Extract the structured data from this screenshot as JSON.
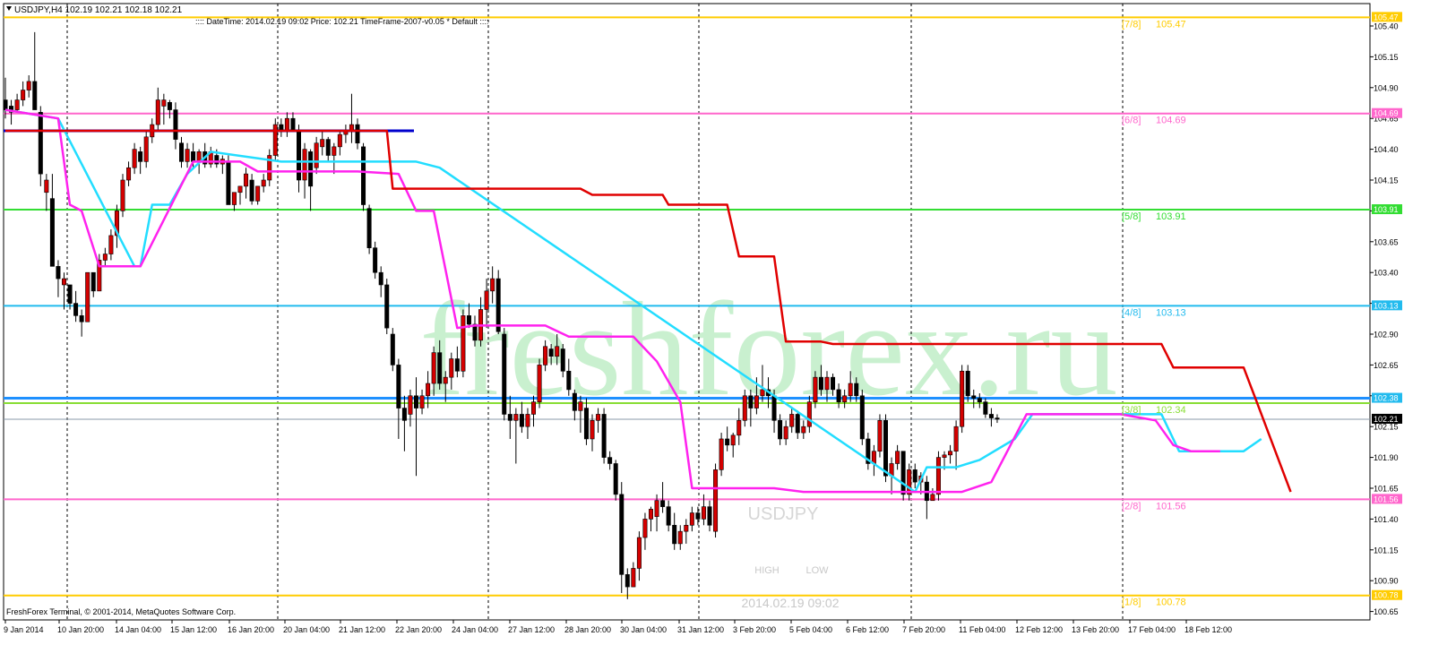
{
  "header": {
    "menu_icon": "triangle-down-icon",
    "symbol_line": "USDJPY,H4  102.19 102.21 102.18 102.21",
    "info_line": ":::: DateTime: 2014.02.19 09:02   Price: 102.21   TimeFrame-2007-v0.05    *  Default   ::::"
  },
  "footer": {
    "copyright": "FreshForex Terminal, © 2001-2014, MetaQuotes Software Corp."
  },
  "watermark": {
    "text": "freshforex.ru",
    "symbol": "USDJPY",
    "time": "2014.02.19 09:02",
    "high": "HIGH",
    "low": "LOW"
  },
  "colors": {
    "bull": "#ffffff",
    "bear": "#000000",
    "bull_body": "#d40000",
    "wick": "#000000",
    "red_line": "#e00000",
    "magenta": "#ff22ee",
    "cyan": "#22ddff",
    "blue_line": "#0000cc",
    "watermark": "#c9f0cf"
  },
  "chart_data": {
    "type": "candlestick",
    "symbol": "USDJPY",
    "timeframe": "H4",
    "ylim": [
      100.55,
      105.6
    ],
    "y_ticks": [
      "105.40",
      "105.15",
      "104.90",
      "104.65",
      "104.40",
      "104.15",
      "103.90",
      "103.65",
      "103.40",
      "103.15",
      "102.90",
      "102.65",
      "102.40",
      "102.15",
      "101.90",
      "101.65",
      "101.40",
      "101.15",
      "100.90",
      "100.65"
    ],
    "x_ticks": [
      "9 Jan 2014",
      "10 Jan 20:00",
      "14 Jan 04:00",
      "15 Jan 12:00",
      "16 Jan 20:00",
      "20 Jan 04:00",
      "21 Jan 12:00",
      "22 Jan 20:00",
      "24 Jan 04:00",
      "27 Jan 12:00",
      "28 Jan 20:00",
      "30 Jan 04:00",
      "31 Jan 12:00",
      "3 Feb 20:00",
      "5 Feb 04:00",
      "6 Feb 12:00",
      "7 Feb 20:00",
      "11 Feb 04:00",
      "12 Feb 12:00",
      "13 Feb 20:00",
      "17 Feb 04:00",
      "18 Feb 12:00"
    ],
    "current_price": "102.21",
    "murrey_levels": [
      {
        "label": "7/8",
        "value": "105.47",
        "color": "#ffcc00"
      },
      {
        "label": "6/8",
        "value": "104.69",
        "color": "#ff66cc"
      },
      {
        "label": "5/8",
        "value": "103.91",
        "color": "#33dd33"
      },
      {
        "label": "4/8",
        "value": "103.13",
        "color": "#22bbee"
      },
      {
        "label": "3/8",
        "value": "102.34",
        "color": "#88dd33"
      },
      {
        "label": "2/8",
        "value": "101.56",
        "color": "#ff66cc"
      },
      {
        "label": "1/8",
        "value": "100.78",
        "color": "#ffcc00"
      }
    ],
    "blue_levels": [
      "104.55",
      "102.38"
    ],
    "right_axis_tags": [
      {
        "value": "105.47",
        "color": "#ffcc00"
      },
      {
        "value": "104.69",
        "color": "#ff66cc"
      },
      {
        "value": "103.91",
        "color": "#33dd33"
      },
      {
        "value": "103.13",
        "color": "#22bbee"
      },
      {
        "value": "102.38",
        "color": "#22bbee"
      },
      {
        "value": "101.56",
        "color": "#ff66cc"
      },
      {
        "value": "100.78",
        "color": "#ffcc00"
      }
    ],
    "candles": [
      [
        104.98,
        104.65,
        104.8,
        104.72
      ],
      [
        104.8,
        104.6,
        104.75,
        104.7
      ],
      [
        104.85,
        104.7,
        104.72,
        104.8
      ],
      [
        104.95,
        104.75,
        104.8,
        104.88
      ],
      [
        105.0,
        104.82,
        104.88,
        104.95
      ],
      [
        105.35,
        104.85,
        104.95,
        104.72
      ],
      [
        104.75,
        104.1,
        104.7,
        104.2
      ],
      [
        104.2,
        103.9,
        104.05,
        104.15
      ],
      [
        104.2,
        103.5,
        104.0,
        103.45
      ],
      [
        103.5,
        103.2,
        103.45,
        103.35
      ],
      [
        103.4,
        103.1,
        103.3,
        103.35
      ],
      [
        103.3,
        103.1,
        103.3,
        103.15
      ],
      [
        103.25,
        103.0,
        103.15,
        103.05
      ],
      [
        103.1,
        102.88,
        103.05,
        103.0
      ],
      [
        103.4,
        103.0,
        103.0,
        103.4
      ],
      [
        103.4,
        103.2,
        103.4,
        103.25
      ],
      [
        103.55,
        103.25,
        103.25,
        103.5
      ],
      [
        103.6,
        103.45,
        103.5,
        103.55
      ],
      [
        103.75,
        103.5,
        103.55,
        103.7
      ],
      [
        103.95,
        103.6,
        103.7,
        103.9
      ],
      [
        104.2,
        103.85,
        103.9,
        104.15
      ],
      [
        104.3,
        104.1,
        104.15,
        104.25
      ],
      [
        104.45,
        104.2,
        104.25,
        104.4
      ],
      [
        104.42,
        104.2,
        104.38,
        104.3
      ],
      [
        104.55,
        104.25,
        104.3,
        104.5
      ],
      [
        104.65,
        104.45,
        104.5,
        104.6
      ],
      [
        104.9,
        104.55,
        104.6,
        104.8
      ],
      [
        104.85,
        104.6,
        104.75,
        104.8
      ],
      [
        104.8,
        104.65,
        104.78,
        104.72
      ],
      [
        104.78,
        104.4,
        104.72,
        104.48
      ],
      [
        104.5,
        104.25,
        104.45,
        104.3
      ],
      [
        104.45,
        104.25,
        104.3,
        104.4
      ],
      [
        104.45,
        104.25,
        104.38,
        104.3
      ],
      [
        104.4,
        104.2,
        104.3,
        104.38
      ],
      [
        104.45,
        104.25,
        104.38,
        104.28
      ],
      [
        104.42,
        104.25,
        104.28,
        104.38
      ],
      [
        104.4,
        104.25,
        104.35,
        104.28
      ],
      [
        104.35,
        104.2,
        104.28,
        104.32
      ],
      [
        104.35,
        104.0,
        104.3,
        103.95
      ],
      [
        104.05,
        103.9,
        103.95,
        104.05
      ],
      [
        104.1,
        103.95,
        104.05,
        104.1
      ],
      [
        104.25,
        104.0,
        104.1,
        104.2
      ],
      [
        104.2,
        103.95,
        104.15,
        103.98
      ],
      [
        104.1,
        103.95,
        103.98,
        104.1
      ],
      [
        104.2,
        104.05,
        104.1,
        104.15
      ],
      [
        104.4,
        104.1,
        104.15,
        104.35
      ],
      [
        104.65,
        104.3,
        104.35,
        104.6
      ],
      [
        104.65,
        104.5,
        104.6,
        104.55
      ],
      [
        104.7,
        104.5,
        104.55,
        104.65
      ],
      [
        104.7,
        104.55,
        104.65,
        104.55
      ],
      [
        104.6,
        104.05,
        104.55,
        104.15
      ],
      [
        104.45,
        104.0,
        104.15,
        104.4
      ],
      [
        104.4,
        103.9,
        104.38,
        104.1
      ],
      [
        104.5,
        104.2,
        104.25,
        104.45
      ],
      [
        104.55,
        104.35,
        104.42,
        104.48
      ],
      [
        104.5,
        104.3,
        104.48,
        104.35
      ],
      [
        104.45,
        104.2,
        104.35,
        104.42
      ],
      [
        104.55,
        104.35,
        104.42,
        104.52
      ],
      [
        104.6,
        104.45,
        104.52,
        104.55
      ],
      [
        104.85,
        104.45,
        104.55,
        104.6
      ],
      [
        104.65,
        104.4,
        104.6,
        104.45
      ],
      [
        104.45,
        103.9,
        104.42,
        103.95
      ],
      [
        103.95,
        103.55,
        103.92,
        103.6
      ],
      [
        103.65,
        103.35,
        103.6,
        103.4
      ],
      [
        103.45,
        103.2,
        103.4,
        103.3
      ],
      [
        103.35,
        102.9,
        103.3,
        102.95
      ],
      [
        102.95,
        102.6,
        102.9,
        102.65
      ],
      [
        102.7,
        102.05,
        102.65,
        102.3
      ],
      [
        102.4,
        101.95,
        102.3,
        102.2
      ],
      [
        102.45,
        102.15,
        102.25,
        102.4
      ],
      [
        102.55,
        101.75,
        102.4,
        102.3
      ],
      [
        102.45,
        102.25,
        102.3,
        102.4
      ],
      [
        102.6,
        102.3,
        102.4,
        102.5
      ],
      [
        102.8,
        102.4,
        102.5,
        102.75
      ],
      [
        102.85,
        102.45,
        102.75,
        102.5
      ],
      [
        102.6,
        102.35,
        102.5,
        102.55
      ],
      [
        102.75,
        102.45,
        102.55,
        102.7
      ],
      [
        102.8,
        102.55,
        102.7,
        102.6
      ],
      [
        103.1,
        102.55,
        102.6,
        103.05
      ],
      [
        103.15,
        102.95,
        103.05,
        102.98
      ],
      [
        103.05,
        102.8,
        102.98,
        102.85
      ],
      [
        103.2,
        102.8,
        102.85,
        103.1
      ],
      [
        103.35,
        102.95,
        103.1,
        103.25
      ],
      [
        103.45,
        103.15,
        103.25,
        103.35
      ],
      [
        103.42,
        102.9,
        103.35,
        102.92
      ],
      [
        102.95,
        102.2,
        102.9,
        102.25
      ],
      [
        102.4,
        102.05,
        102.25,
        102.2
      ],
      [
        102.3,
        101.85,
        102.2,
        102.25
      ],
      [
        102.35,
        102.1,
        102.25,
        102.15
      ],
      [
        102.3,
        102.05,
        102.15,
        102.25
      ],
      [
        102.4,
        102.15,
        102.25,
        102.35
      ],
      [
        102.7,
        102.3,
        102.35,
        102.65
      ],
      [
        102.85,
        102.6,
        102.65,
        102.8
      ],
      [
        102.82,
        102.65,
        102.78,
        102.72
      ],
      [
        102.9,
        102.65,
        102.72,
        102.8
      ],
      [
        102.82,
        102.55,
        102.78,
        102.6
      ],
      [
        102.7,
        102.4,
        102.6,
        102.45
      ],
      [
        102.45,
        102.2,
        102.42,
        102.28
      ],
      [
        102.4,
        102.1,
        102.28,
        102.35
      ],
      [
        102.38,
        102.0,
        102.3,
        102.05
      ],
      [
        102.25,
        101.95,
        102.05,
        102.2
      ],
      [
        102.3,
        102.1,
        102.2,
        102.25
      ],
      [
        102.3,
        101.85,
        102.25,
        101.9
      ],
      [
        101.95,
        101.8,
        101.9,
        101.85
      ],
      [
        101.88,
        101.55,
        101.85,
        101.6
      ],
      [
        101.7,
        100.8,
        101.6,
        100.95
      ],
      [
        101.0,
        100.75,
        100.95,
        100.85
      ],
      [
        101.05,
        100.85,
        100.85,
        101.0
      ],
      [
        101.3,
        100.9,
        101.0,
        101.25
      ],
      [
        101.45,
        101.15,
        101.25,
        101.4
      ],
      [
        101.5,
        101.3,
        101.4,
        101.48
      ],
      [
        101.6,
        101.3,
        101.42,
        101.55
      ],
      [
        101.7,
        101.45,
        101.55,
        101.5
      ],
      [
        101.55,
        101.3,
        101.5,
        101.35
      ],
      [
        101.45,
        101.15,
        101.35,
        101.2
      ],
      [
        101.35,
        101.15,
        101.2,
        101.3
      ],
      [
        101.4,
        101.2,
        101.3,
        101.35
      ],
      [
        101.5,
        101.3,
        101.35,
        101.45
      ],
      [
        101.5,
        101.35,
        101.45,
        101.4
      ],
      [
        101.6,
        101.35,
        101.4,
        101.5
      ],
      [
        101.55,
        101.3,
        101.5,
        101.35
      ],
      [
        101.85,
        101.25,
        101.3,
        101.8
      ],
      [
        102.1,
        101.75,
        101.8,
        102.05
      ],
      [
        102.15,
        101.95,
        102.05,
        102.0
      ],
      [
        102.1,
        101.9,
        102.0,
        102.08
      ],
      [
        102.3,
        102.0,
        102.08,
        102.2
      ],
      [
        102.45,
        102.15,
        102.2,
        102.4
      ],
      [
        102.45,
        102.15,
        102.4,
        102.3
      ],
      [
        102.55,
        102.25,
        102.3,
        102.4
      ],
      [
        102.65,
        102.35,
        102.4,
        102.45
      ],
      [
        102.55,
        102.3,
        102.45,
        102.4
      ],
      [
        102.45,
        102.1,
        102.4,
        102.2
      ],
      [
        102.25,
        102.0,
        102.2,
        102.05
      ],
      [
        102.2,
        102.0,
        102.05,
        102.15
      ],
      [
        102.3,
        102.1,
        102.15,
        102.25
      ],
      [
        102.28,
        102.05,
        102.25,
        102.1
      ],
      [
        102.2,
        102.05,
        102.1,
        102.15
      ],
      [
        102.4,
        102.1,
        102.15,
        102.35
      ],
      [
        102.6,
        102.3,
        102.35,
        102.55
      ],
      [
        102.65,
        102.4,
        102.55,
        102.45
      ],
      [
        102.6,
        102.35,
        102.45,
        102.55
      ],
      [
        102.58,
        102.4,
        102.55,
        102.45
      ],
      [
        102.5,
        102.3,
        102.45,
        102.35
      ],
      [
        102.45,
        102.3,
        102.35,
        102.4
      ],
      [
        102.6,
        102.35,
        102.4,
        102.5
      ],
      [
        102.55,
        102.35,
        102.5,
        102.4
      ],
      [
        102.45,
        102.0,
        102.4,
        102.05
      ],
      [
        102.1,
        101.8,
        102.05,
        101.85
      ],
      [
        102.0,
        101.75,
        101.85,
        101.95
      ],
      [
        102.25,
        101.9,
        101.95,
        102.2
      ],
      [
        102.25,
        101.7,
        102.2,
        101.75
      ],
      [
        101.9,
        101.6,
        101.75,
        101.85
      ],
      [
        102.0,
        101.8,
        101.85,
        101.95
      ],
      [
        101.95,
        101.55,
        101.95,
        101.6
      ],
      [
        101.85,
        101.55,
        101.6,
        101.8
      ],
      [
        101.85,
        101.65,
        101.8,
        101.7
      ],
      [
        101.78,
        101.6,
        101.7,
        101.75
      ],
      [
        101.75,
        101.4,
        101.7,
        101.55
      ],
      [
        101.65,
        101.55,
        101.55,
        101.6
      ],
      [
        101.95,
        101.55,
        101.6,
        101.9
      ],
      [
        101.95,
        101.8,
        101.9,
        101.92
      ],
      [
        102.0,
        101.85,
        101.92,
        101.95
      ],
      [
        102.2,
        101.8,
        101.95,
        102.15
      ],
      [
        102.65,
        102.1,
        102.15,
        102.6
      ],
      [
        102.65,
        102.35,
        102.6,
        102.4
      ],
      [
        102.45,
        102.3,
        102.4,
        102.38
      ],
      [
        102.42,
        102.3,
        102.38,
        102.35
      ],
      [
        102.38,
        102.22,
        102.35,
        102.25
      ],
      [
        102.3,
        102.15,
        102.25,
        102.22
      ],
      [
        102.25,
        102.18,
        102.22,
        102.21
      ]
    ],
    "red_line": [
      [
        0,
        104.55
      ],
      [
        65,
        104.55
      ],
      [
        66,
        104.08
      ],
      [
        98,
        104.08
      ],
      [
        100,
        104.03
      ],
      [
        112,
        104.03
      ],
      [
        113,
        103.95
      ],
      [
        123,
        103.95
      ],
      [
        125,
        103.53
      ],
      [
        131,
        103.53
      ],
      [
        133,
        102.84
      ],
      [
        139,
        102.84
      ],
      [
        141,
        102.82
      ],
      [
        197,
        102.82
      ],
      [
        199,
        102.63
      ],
      [
        211,
        102.63
      ],
      [
        213,
        102.38
      ],
      [
        219,
        101.62
      ]
    ],
    "magenta_line": [
      [
        0,
        104.72
      ],
      [
        9,
        104.65
      ],
      [
        11,
        103.95
      ],
      [
        13,
        103.9
      ],
      [
        16,
        103.45
      ],
      [
        22,
        103.45
      ],
      [
        23,
        103.45
      ],
      [
        32,
        104.3
      ],
      [
        40,
        104.3
      ],
      [
        43,
        104.22
      ],
      [
        60,
        104.22
      ],
      [
        67,
        104.2
      ],
      [
        70,
        103.9
      ],
      [
        73,
        103.9
      ],
      [
        77,
        102.95
      ],
      [
        80,
        102.97
      ],
      [
        92,
        102.97
      ],
      [
        96,
        102.88
      ],
      [
        107,
        102.88
      ],
      [
        111,
        102.68
      ],
      [
        115,
        102.35
      ],
      [
        117,
        101.65
      ],
      [
        131,
        101.65
      ],
      [
        136,
        101.62
      ],
      [
        152,
        101.62
      ],
      [
        163,
        101.62
      ],
      [
        168,
        101.7
      ],
      [
        174,
        102.25
      ],
      [
        183,
        102.25
      ],
      [
        190,
        102.25
      ],
      [
        196,
        102.2
      ],
      [
        199,
        102.0
      ],
      [
        202,
        101.95
      ],
      [
        207,
        101.95
      ]
    ],
    "cyan_line": [
      [
        0,
        104.72
      ],
      [
        9,
        104.65
      ],
      [
        22,
        103.45
      ],
      [
        23,
        103.45
      ],
      [
        25,
        103.95
      ],
      [
        28,
        103.95
      ],
      [
        31,
        104.2
      ],
      [
        35,
        104.38
      ],
      [
        47,
        104.3
      ],
      [
        70,
        104.3
      ],
      [
        74,
        104.25
      ],
      [
        155,
        101.62
      ],
      [
        157,
        101.82
      ],
      [
        162,
        101.82
      ],
      [
        166,
        101.88
      ],
      [
        172,
        102.05
      ],
      [
        175,
        102.25
      ],
      [
        197,
        102.25
      ],
      [
        200,
        101.95
      ],
      [
        211,
        101.95
      ],
      [
        214,
        102.05
      ]
    ]
  }
}
